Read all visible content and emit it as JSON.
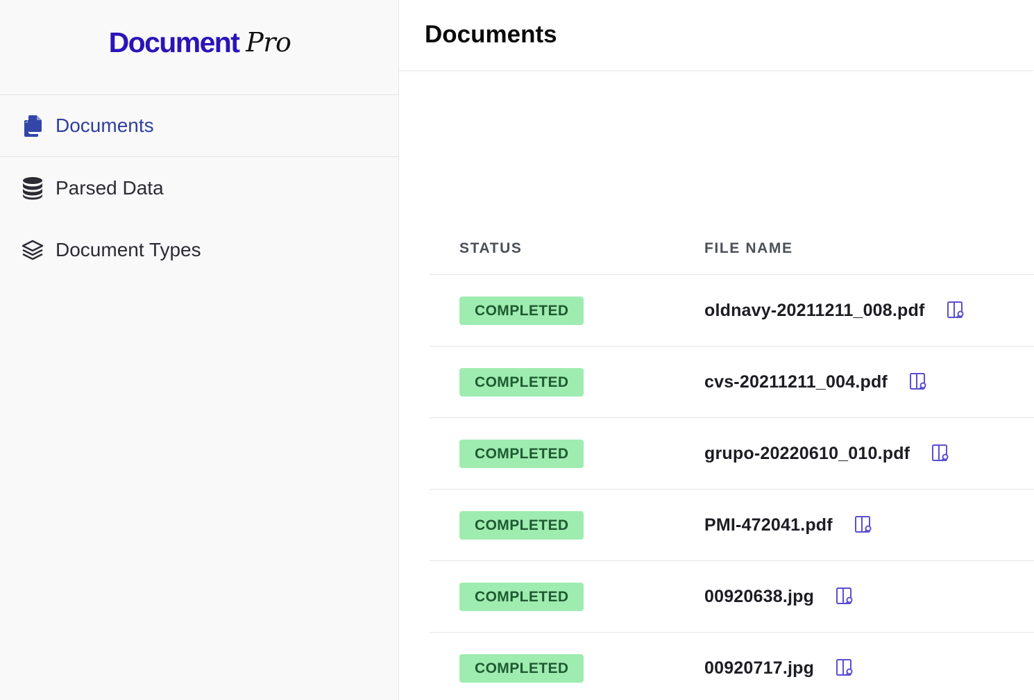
{
  "brand": {
    "name_main": "Document",
    "name_script": "Pro",
    "color": "#2b14b8"
  },
  "sidebar": {
    "items": [
      {
        "label": "Documents",
        "icon": "documents-icon",
        "active": true
      },
      {
        "label": "Parsed Data",
        "icon": "database-icon",
        "active": false
      },
      {
        "label": "Document Types",
        "icon": "layers-icon",
        "active": false
      }
    ]
  },
  "header": {
    "title": "Documents"
  },
  "table": {
    "columns": [
      "STATUS",
      "FILE NAME"
    ],
    "rows": [
      {
        "status": "COMPLETED",
        "file_name": "oldnavy-20211211_008.pdf",
        "action_icon": "view-document-icon"
      },
      {
        "status": "COMPLETED",
        "file_name": "cvs-20211211_004.pdf",
        "action_icon": "view-document-icon"
      },
      {
        "status": "COMPLETED",
        "file_name": "grupo-20220610_010.pdf",
        "action_icon": "view-document-icon"
      },
      {
        "status": "COMPLETED",
        "file_name": "PMI-472041.pdf",
        "action_icon": "view-document-icon"
      },
      {
        "status": "COMPLETED",
        "file_name": "00920638.jpg",
        "action_icon": "view-document-icon"
      },
      {
        "status": "COMPLETED",
        "file_name": "00920717.jpg",
        "action_icon": "view-document-icon"
      }
    ]
  },
  "colors": {
    "accent": "#2f3f9e",
    "badge_bg": "#9fecb0",
    "badge_text": "#1f5a32",
    "icon_purple": "#5a4fd0"
  }
}
